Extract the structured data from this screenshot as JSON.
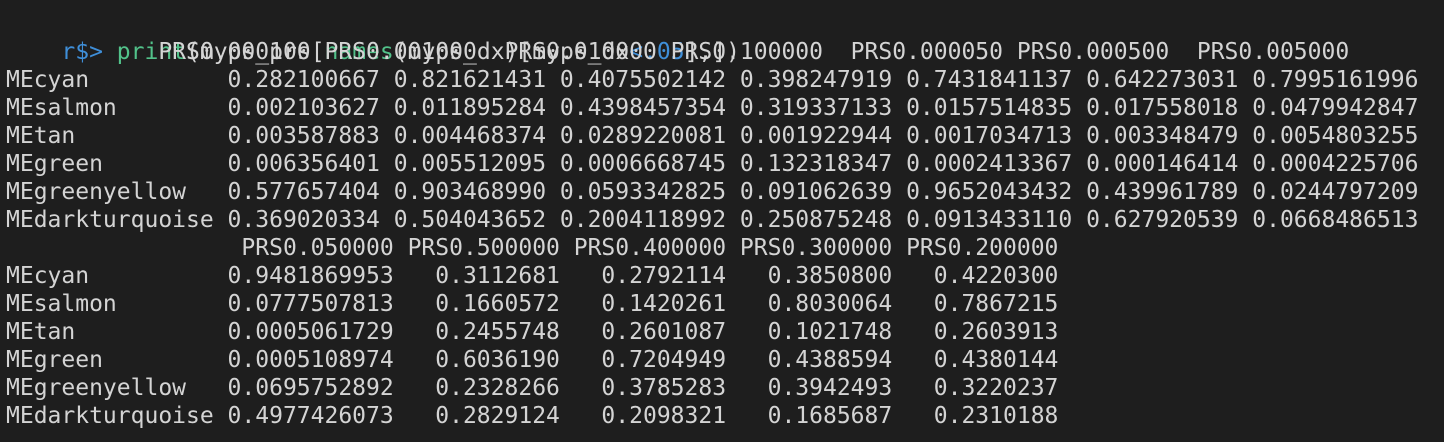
{
  "command": {
    "prompt": "r$>",
    "space": " ",
    "func_print": "print",
    "paren_open": "(",
    "var": "myps_prs",
    "bracket_open": "[",
    "func_names": "names",
    "arg": "(myps_dx)[myps_dx",
    "op": "<",
    "num": ".05",
    "tail": "],])"
  },
  "output_lines": [
    "           PRS0.000100 PRS0.001000  PRS0.010000 PRS0.100000  PRS0.000050 PRS0.000500  PRS0.005000",
    "MEcyan          0.282100667 0.821621431 0.4075502142 0.398247919 0.7431841137 0.642273031 0.7995161996",
    "MEsalmon        0.002103627 0.011895284 0.4398457354 0.319337133 0.0157514835 0.017558018 0.0479942847",
    "MEtan           0.003587883 0.004468374 0.0289220081 0.001922944 0.0017034713 0.003348479 0.0054803255",
    "MEgreen         0.006356401 0.005512095 0.0006668745 0.132318347 0.0002413367 0.000146414 0.0004225706",
    "MEgreenyellow   0.577657404 0.903468990 0.0593342825 0.091062639 0.9652043432 0.439961789 0.0244797209",
    "MEdarkturquoise 0.369020334 0.504043652 0.2004118992 0.250875248 0.0913433110 0.627920539 0.0668486513",
    "                 PRS0.050000 PRS0.500000 PRS0.400000 PRS0.300000 PRS0.200000",
    "MEcyan          0.9481869953   0.3112681   0.2792114   0.3850800   0.4220300",
    "MEsalmon        0.0777507813   0.1660572   0.1420261   0.8030064   0.7867215",
    "MEtan           0.0005061729   0.2455748   0.2601087   0.1021748   0.2603913",
    "MEgreen         0.0005108974   0.6036190   0.7204949   0.4388594   0.4380144",
    "MEgreenyellow   0.0695752892   0.2328266   0.3785283   0.3942493   0.3220237",
    "MEdarkturquoise 0.4977426073   0.2829124   0.2098321   0.1685687   0.2310188"
  ],
  "colors": {
    "background": "#1e1e1e",
    "text": "#d4d4d4",
    "prompt": "#3f8fd9",
    "function": "#52c28a"
  }
}
